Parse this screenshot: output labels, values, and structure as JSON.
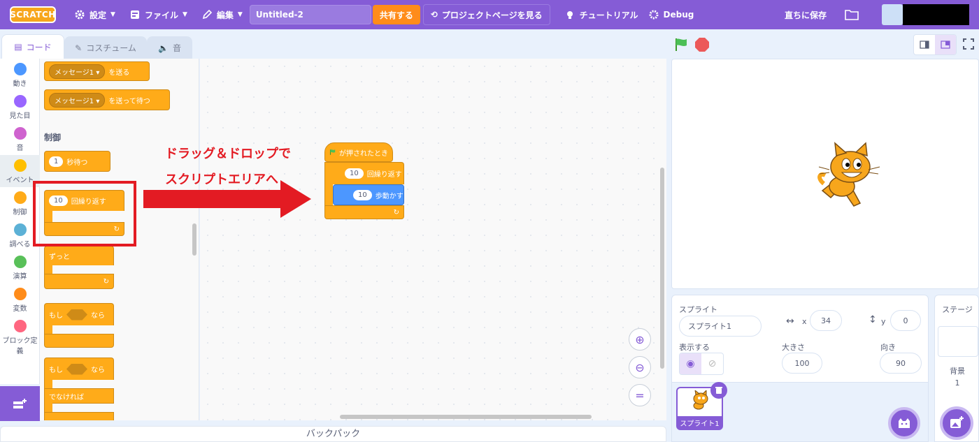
{
  "menubar": {
    "logo": "SCRATCH",
    "settings": "設定",
    "file": "ファイル",
    "edit": "編集",
    "project_title": "Untitled-2",
    "share": "共有する",
    "project_page": "プロジェクトページを見る",
    "tutorials": "チュートリアル",
    "debug": "Debug",
    "save_now": "直ちに保存"
  },
  "tabs": {
    "code": "コード",
    "costumes": "コスチューム",
    "sounds": "音"
  },
  "categories": [
    {
      "label": "動き",
      "color": "#4c97ff"
    },
    {
      "label": "見た目",
      "color": "#9966ff"
    },
    {
      "label": "音",
      "color": "#cf63cf"
    },
    {
      "label": "イベント",
      "color": "#ffbf00"
    },
    {
      "label": "制御",
      "color": "#ffab19"
    },
    {
      "label": "調べる",
      "color": "#5cb1d6"
    },
    {
      "label": "演算",
      "color": "#59c059"
    },
    {
      "label": "変数",
      "color": "#ff8c1a"
    },
    {
      "label": "ブロック定義",
      "color": "#ff6680"
    }
  ],
  "palette": {
    "broadcast_msg": "メッセージ1",
    "broadcast": "を送る",
    "broadcast_wait": "を送って待つ",
    "control_label": "制御",
    "wait_value": "1",
    "wait": "秒待つ",
    "repeat_value": "10",
    "repeat": "回繰り返す",
    "forever": "ずっと",
    "if": "もし",
    "then": "なら",
    "else": "でなければ"
  },
  "script": {
    "hat": "が押されたとき",
    "repeat_value": "10",
    "repeat": "回繰り返す",
    "move_value": "10",
    "move": "歩動かす"
  },
  "annotation": {
    "line1": "ドラッグ＆ドロップで",
    "line2": "スクリプトエリアへ"
  },
  "backpack": "バックパック",
  "sprite_info": {
    "sprite_label": "スプライト",
    "sprite_name": "スプライト1",
    "x_label": "x",
    "x_value": "34",
    "y_label": "y",
    "y_value": "0",
    "show_label": "表示する",
    "size_label": "大きさ",
    "size_value": "100",
    "direction_label": "向き",
    "direction_value": "90"
  },
  "sprite_tile_name": "スプライト1",
  "stage_panel": {
    "title": "ステージ",
    "backdrops_label": "背景",
    "backdrops_count": "1"
  },
  "colors": {
    "accent": "#855cd6",
    "control": "#ffab19",
    "motion": "#4c97ff",
    "annotation": "#e31b23"
  }
}
